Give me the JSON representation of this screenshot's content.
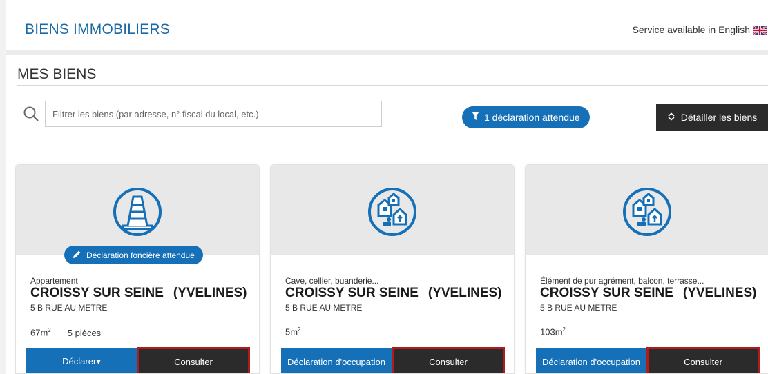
{
  "header": {
    "title": "BIENS IMMOBILIERS",
    "language_link": "Service available in English"
  },
  "section": {
    "title": "MES BIENS"
  },
  "search": {
    "placeholder": "Filtrer les biens (par adresse, n° fiscal du local, etc.)",
    "value": ""
  },
  "filter_pill": {
    "label": "1 déclaration attendue",
    "icon": "funnel-icon"
  },
  "detail_button": {
    "label": "Détailler les biens",
    "icon": "chevron-updown-icon"
  },
  "colors": {
    "accent": "#1570b8",
    "dark": "#2b2b2b",
    "highlight": "#b01c1c",
    "title": "#1b6aa5"
  },
  "cards": [
    {
      "icon": "apartment-building-icon",
      "badge": "Déclaration foncière attendue",
      "type": "Appartement",
      "city": "CROISSY SUR SEINE",
      "department": "(YVELINES)",
      "address": "5 B RUE AU METRE",
      "area_value": "67m",
      "area_exp": "2",
      "rooms": "5 pièces",
      "left_button": "Déclarer▾",
      "consult_button": "Consulter"
    },
    {
      "icon": "dependencies-icon",
      "badge": "",
      "type": "Cave, cellier, buanderie...",
      "city": "CROISSY SUR SEINE",
      "department": "(YVELINES)",
      "address": "5 B RUE AU METRE",
      "area_value": "5m",
      "area_exp": "2",
      "rooms": "",
      "left_button": "Déclaration d'occupation",
      "consult_button": "Consulter"
    },
    {
      "icon": "dependencies-icon",
      "badge": "",
      "type": "Élément de pur agrément, balcon, terrasse...",
      "city": "CROISSY SUR SEINE",
      "department": "(YVELINES)",
      "address": "5 B RUE AU METRE",
      "area_value": "103m",
      "area_exp": "2",
      "rooms": "",
      "left_button": "Déclaration d'occupation",
      "consult_button": "Consulter"
    }
  ]
}
